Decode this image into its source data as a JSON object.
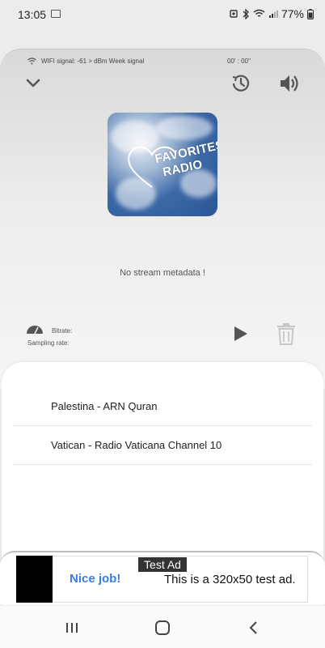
{
  "status_bar": {
    "time": "13:05",
    "battery": "77%",
    "icons": [
      "gallery-icon",
      "alarm-icon",
      "bluetooth-icon",
      "wifi-icon",
      "cell-signal-icon",
      "battery-icon"
    ]
  },
  "player": {
    "wifi_signal_text": "WIFI signal: -61 > dBm Week signal",
    "timer": "00' : 00''",
    "cover_text_line1": "FAVORITES",
    "cover_text_line2": "RADIO",
    "metadata": "No stream metadata !",
    "bitrate_label": "Bitrate:",
    "sampling_label": "Sampling rate:"
  },
  "stations": [
    {
      "name": "Palestina - ARN Quran"
    },
    {
      "name": "Vatican - Radio Vaticana Channel 10"
    }
  ],
  "ad": {
    "label": "Test Ad",
    "nice": "Nice job!",
    "text": "This is a 320x50 test ad."
  },
  "colors": {
    "accent_blue": "#3b7ddd",
    "icon_gray": "#555555"
  }
}
